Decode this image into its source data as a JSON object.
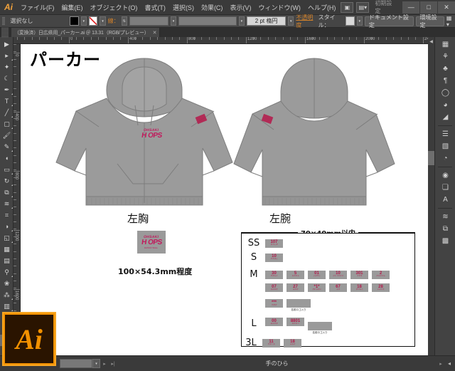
{
  "app": {
    "name": "Ai",
    "title": "Adobe Illustrator"
  },
  "menubar": {
    "items": [
      {
        "label": "ファイル(F)"
      },
      {
        "label": "編集(E)"
      },
      {
        "label": "オブジェクト(O)"
      },
      {
        "label": "書式(T)"
      },
      {
        "label": "選択(S)"
      },
      {
        "label": "効果(C)"
      },
      {
        "label": "表示(V)"
      },
      {
        "label": "ウィンドウ(W)"
      },
      {
        "label": "ヘルプ(H)"
      }
    ],
    "workspace_label": "初期設定",
    "window_buttons": {
      "minimize": "—",
      "maximize": "□",
      "close": "✕"
    }
  },
  "controlbar": {
    "selection_status": "選択なし",
    "stroke_weight": "2 pt 楕円",
    "opacity_label": "不透明度",
    "style_label": "スタイル：",
    "doc_setup_button": "ドキュメント設定",
    "preferences_button": "環境設定"
  },
  "tabbar": {
    "document_title": "（変換済）日広県用_パーカー.ai ＠ 13.31（RGB/プレビュー）",
    "close_label": "✕"
  },
  "toolbox": {
    "tools": [
      {
        "name": "selection-tool",
        "glyph": "▶"
      },
      {
        "name": "direct-selection-tool",
        "glyph": "▸"
      },
      {
        "name": "magic-wand-tool",
        "glyph": "✦"
      },
      {
        "name": "lasso-tool",
        "glyph": "◌"
      },
      {
        "name": "pen-tool",
        "glyph": "✒"
      },
      {
        "name": "type-tool",
        "glyph": "T"
      },
      {
        "name": "line-segment-tool",
        "glyph": "╱"
      },
      {
        "name": "rectangle-tool",
        "glyph": "□"
      },
      {
        "name": "paintbrush-tool",
        "glyph": "✐"
      },
      {
        "name": "pencil-tool",
        "glyph": "✎"
      },
      {
        "name": "blob-brush-tool",
        "glyph": "◖"
      },
      {
        "name": "eraser-tool",
        "glyph": "▭"
      },
      {
        "name": "rotate-tool",
        "glyph": "↻"
      },
      {
        "name": "scale-tool",
        "glyph": "⤡"
      },
      {
        "name": "width-tool",
        "glyph": "≈"
      },
      {
        "name": "free-transform-tool",
        "glyph": "⌗"
      },
      {
        "name": "shape-builder-tool",
        "glyph": "◑"
      },
      {
        "name": "perspective-grid-tool",
        "glyph": "◱"
      },
      {
        "name": "mesh-tool",
        "glyph": "⌗"
      },
      {
        "name": "gradient-tool",
        "glyph": "▤"
      },
      {
        "name": "eyedropper-tool",
        "glyph": "⚗"
      },
      {
        "name": "blend-tool",
        "glyph": "⚭"
      },
      {
        "name": "symbol-sprayer-tool",
        "glyph": "⁂"
      },
      {
        "name": "column-graph-tool",
        "glyph": "▒"
      },
      {
        "name": "artboard-tool",
        "glyph": "❐"
      },
      {
        "name": "slice-tool",
        "glyph": "✂"
      },
      {
        "name": "hand-tool",
        "glyph": "✋",
        "selected": true
      },
      {
        "name": "zoom-tool",
        "glyph": "⌕"
      }
    ]
  },
  "rulers": {
    "horizontal_units": [
      "0",
      "400",
      "800",
      "1200",
      "1600",
      "2000",
      "2400"
    ],
    "vertical_units": [
      "0",
      "400",
      "800",
      "1200",
      "1600"
    ]
  },
  "canvas": {
    "title": "パーカー",
    "chest_label": "左胸",
    "arm_label": "左腕",
    "chest_dimension": "100×54.3mm程度",
    "arm_dimension": "70×40mm以内",
    "logo": {
      "top": "OHSAKI",
      "main": "H   OPS",
      "sub": "BASKETBALL"
    }
  },
  "size_table": {
    "header": "70×40mm以内",
    "rows": [
      {
        "size": "SS",
        "chips": [
          {
            "number": "107",
            "sub": "ひろしま"
          }
        ]
      },
      {
        "size": "S",
        "chips": [
          {
            "number": "10",
            "sub": "たかはし"
          }
        ]
      },
      {
        "size": "M",
        "chips": [
          {
            "number": "30",
            "sub": "やまもと"
          },
          {
            "number": "5",
            "sub": "なかむら"
          },
          {
            "number": "01",
            "sub": "こばやし"
          },
          {
            "number": "10",
            "sub": "さとうたろう"
          },
          {
            "number": "301",
            "sub": "すずき"
          },
          {
            "number": "2",
            "sub": "たなかけん"
          }
        ]
      },
      {
        "size": "",
        "chips": [
          {
            "number": "07",
            "sub": "ちばゆき"
          },
          {
            "number": "27",
            "sub": "おかだ"
          },
          {
            "number": "*1*",
            "sub": "きむらだい"
          },
          {
            "number": "67",
            "sub": "もり"
          },
          {
            "number": "18",
            "sub": "まつもと"
          },
          {
            "number": "28",
            "sub": "いのうえ"
          }
        ]
      },
      {
        "size": "",
        "chips": [
          {
            "number": "***",
            "sub": "やまだ"
          }
        ],
        "name_chips": [
          {
            "caption": "名前ロゴ入り"
          }
        ]
      },
      {
        "size": "L",
        "chips": [
          {
            "number": "00",
            "sub": "あおやま"
          },
          {
            "number": "8801",
            "sub": "わたなべ"
          }
        ],
        "name_chips": [
          {
            "caption": "名前ロゴ入り"
          }
        ]
      },
      {
        "size": "3L",
        "chips": [
          {
            "number": "11",
            "sub": "やまぐち"
          },
          {
            "number": "18",
            "sub": "おおた"
          }
        ]
      }
    ]
  },
  "right_panel": {
    "icons": [
      {
        "name": "color-panel-icon",
        "glyph": "▦"
      },
      {
        "name": "color-guide-icon",
        "glyph": "⚘"
      },
      {
        "name": "brushes-panel-icon",
        "glyph": "♣"
      },
      {
        "name": "symbols-panel-icon",
        "glyph": "¶"
      },
      {
        "name": "stroke-panel-icon",
        "glyph": "◯"
      },
      {
        "name": "swatches-panel-icon",
        "glyph": "◕"
      },
      {
        "name": "gradient-panel-icon",
        "glyph": "◢"
      },
      {
        "name": "paragraph-panel-icon",
        "glyph": "☰"
      },
      {
        "name": "align-panel-icon",
        "glyph": "▧"
      },
      {
        "name": "transparency-panel-icon",
        "glyph": "◔"
      },
      {
        "name": "appearance-panel-icon",
        "glyph": "◉"
      },
      {
        "name": "graphic-styles-icon",
        "glyph": "❐"
      },
      {
        "name": "character-panel-icon",
        "glyph": "A"
      },
      {
        "name": "layers-panel-icon",
        "glyph": "≣"
      },
      {
        "name": "artboards-panel-icon",
        "glyph": "⧉"
      },
      {
        "name": "links-panel-icon",
        "glyph": "░"
      }
    ],
    "collapse_glyph": "◀"
  },
  "statusbar": {
    "zoom_value": "",
    "status_text": "手のひら",
    "prev_glyph": "▸",
    "last_glyph": "▸|",
    "next_glyph": "▸",
    "menu_glyph": "◂"
  }
}
